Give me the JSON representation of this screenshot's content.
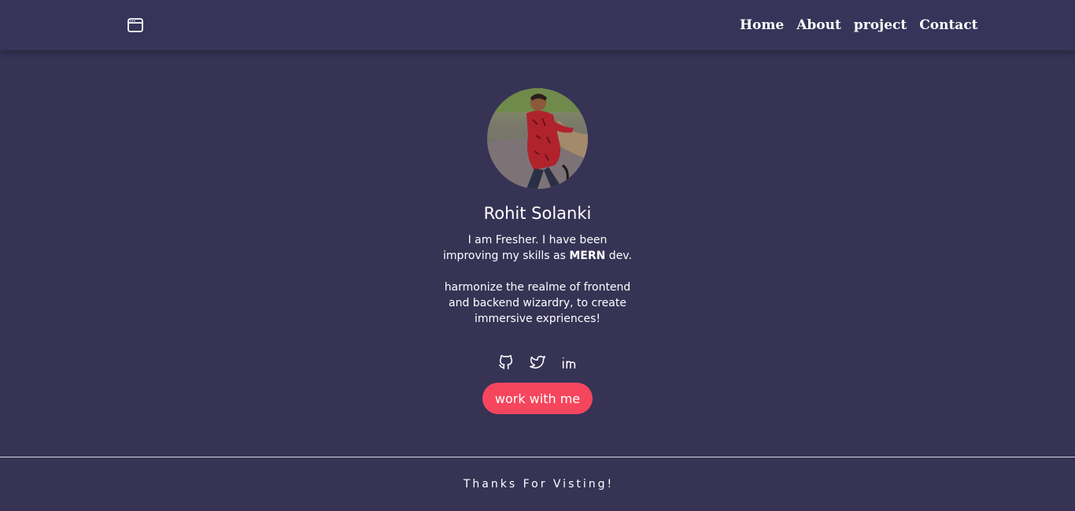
{
  "nav": {
    "links": [
      {
        "label": "Home"
      },
      {
        "label": "About"
      },
      {
        "label": "project"
      },
      {
        "label": "Contact"
      }
    ]
  },
  "profile": {
    "name": "Rohit Solanki",
    "bio_line1_pre": "I am Fresher. I have been improving my skills as ",
    "bio_line1_bold": "MERN",
    "bio_line1_post": " dev.",
    "bio_line2": "harmonize the realme of frontend and backend wizardry, to create immersive expriences!"
  },
  "social": [
    {
      "icon": "github-icon"
    },
    {
      "icon": "twitter-icon"
    },
    {
      "icon": "linkedin-icon"
    }
  ],
  "cta": {
    "label": "work with me"
  },
  "footer": {
    "text": "Thanks For Visting!"
  },
  "colors": {
    "background": "#363355",
    "accent": "#f5465e",
    "text": "#ffffff"
  }
}
